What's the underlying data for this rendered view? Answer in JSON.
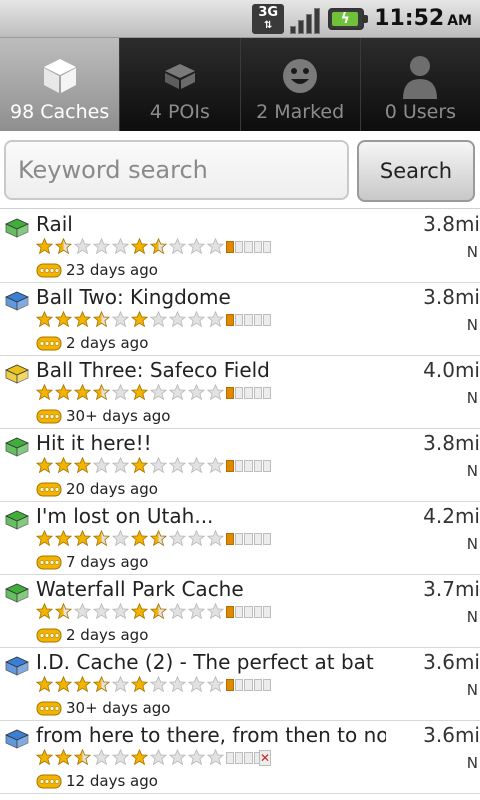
{
  "status_bar": {
    "network": "3G",
    "time": "11:52",
    "ampm": "AM"
  },
  "tabs": [
    {
      "label": "98 Caches",
      "icon": "cube-icon",
      "active": true
    },
    {
      "label": "4 POIs",
      "icon": "poi-icon",
      "active": false
    },
    {
      "label": "2 Marked",
      "icon": "smiley-icon",
      "active": false
    },
    {
      "label": "0 Users",
      "icon": "user-icon",
      "active": false
    }
  ],
  "search": {
    "placeholder": "Keyword search",
    "value": "",
    "button_label": "Search"
  },
  "caches": [
    {
      "title": "Rail",
      "type": "green",
      "difficulty": 1.5,
      "terrain": 1.5,
      "size": 1,
      "size_unknown": false,
      "age": "23 days ago",
      "distance": "3.8mi",
      "direction": "N"
    },
    {
      "title": "Ball Two: Kingdome",
      "type": "blue",
      "difficulty": 3.5,
      "terrain": 1,
      "size": 1,
      "size_unknown": false,
      "age": "2 days ago",
      "distance": "3.8mi",
      "direction": "N"
    },
    {
      "title": "Ball Three: Safeco Field",
      "type": "yellow",
      "difficulty": 3.5,
      "terrain": 1,
      "size": 1,
      "size_unknown": false,
      "age": "30+ days ago",
      "distance": "4.0mi",
      "direction": "N"
    },
    {
      "title": "Hit it here!!",
      "type": "green",
      "difficulty": 3,
      "terrain": 1,
      "size": 1,
      "size_unknown": false,
      "age": "20 days ago",
      "distance": "3.8mi",
      "direction": "N"
    },
    {
      "title": "I'm lost on Utah...",
      "type": "green",
      "difficulty": 3.5,
      "terrain": 1.5,
      "size": 1,
      "size_unknown": false,
      "age": "7 days ago",
      "distance": "4.2mi",
      "direction": "N"
    },
    {
      "title": "Waterfall Park Cache",
      "type": "green",
      "difficulty": 1.5,
      "terrain": 1.5,
      "size": 1,
      "size_unknown": false,
      "age": "2 days ago",
      "distance": "3.7mi",
      "direction": "N"
    },
    {
      "title": "I.D. Cache (2) - The perfect at bat",
      "type": "blue",
      "difficulty": 3.5,
      "terrain": 1,
      "size": 1,
      "size_unknown": false,
      "age": "30+ days ago",
      "distance": "3.6mi",
      "direction": "N"
    },
    {
      "title": "from here to there, from then to now.",
      "type": "blue",
      "difficulty": 2.5,
      "terrain": 1,
      "size": 0,
      "size_unknown": true,
      "age": "12 days ago",
      "distance": "3.6mi",
      "direction": "N"
    }
  ],
  "colors": {
    "star_fill": "#f2b400",
    "star_empty": "#e2e2e2",
    "cache_green": "#3fae3a",
    "cache_blue": "#3b7fd4",
    "cache_yellow": "#e8c21a",
    "active_tab": "#a8a8a8"
  }
}
